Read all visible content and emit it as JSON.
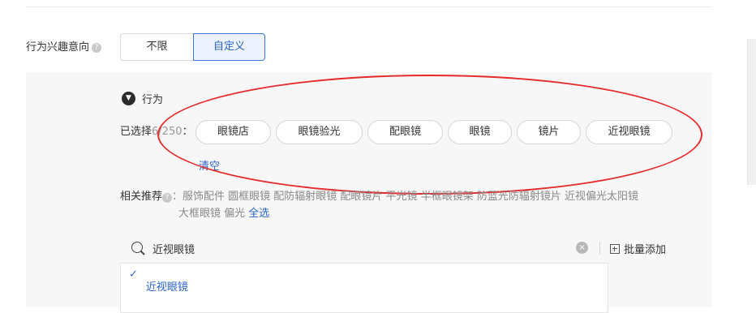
{
  "row": {
    "label": "行为兴趣意向",
    "help": "?"
  },
  "segmented": {
    "options": [
      "不限",
      "自定义"
    ],
    "selected": "自定义"
  },
  "category": {
    "title": "行为",
    "toggle": "❯"
  },
  "selected": {
    "label": "已选择",
    "count_text": "6/250",
    "colon": "：",
    "chips": [
      "眼镜店",
      "眼镜验光",
      "配眼镜",
      "眼镜",
      "镜片",
      "近视眼镜"
    ],
    "clear": "清空"
  },
  "recommend": {
    "label": "相关推荐",
    "help": "?",
    "colon": "：",
    "line1": "服饰配件 圆框眼镜 配防辐射眼镜 配眼镜片 平光镜 半框眼镜架 防蓝光防辐射镜片 近视偏光太阳镜",
    "line2": "大框眼镜 偏光",
    "select_all": "全选"
  },
  "search": {
    "value": "近视眼镜",
    "clear": "×",
    "batch_add": "批量添加"
  },
  "dropdown": {
    "items": [
      {
        "check": "✓",
        "label": "近视眼镜"
      }
    ]
  },
  "colors": {
    "accent": "#2a62c9",
    "annotation": "#e52b2b",
    "panel": "#f7f7f7"
  }
}
